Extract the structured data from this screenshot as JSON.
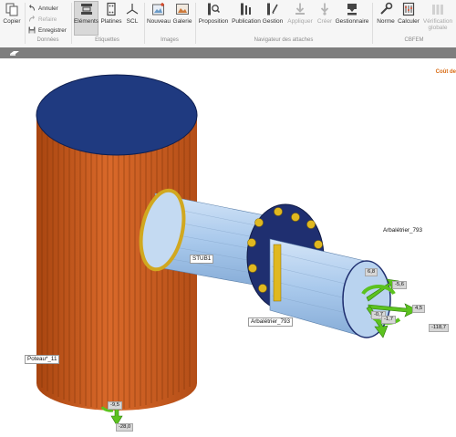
{
  "ribbon": {
    "copy_label": "Copier",
    "undo_label": "Annuler",
    "redo_label": "Refaire",
    "save_label": "Enregistrer",
    "group_data": "Données",
    "elements_label": "Eléments",
    "plates_label": "Platines",
    "scl_label": "SCL",
    "group_labels": "Etiquettes",
    "new_label": "Nouveau",
    "gallery_label": "Galerie",
    "group_images": "Images",
    "proposition_label": "Proposition",
    "publication_label": "Publication",
    "management_label": "Gestion",
    "apply_label": "Appliquer",
    "create_label": "Créer",
    "manager_label": "Gestionnaire",
    "group_navigator": "Navigateur des attaches",
    "norm_label": "Norme",
    "calculate_label": "Calculer",
    "verification_label_1": "Vérification",
    "verification_label_2": "globale",
    "group_cbfem": "CBFEM"
  },
  "viewport": {
    "cost_link": "Coût de",
    "labels": {
      "stub": "STUB1",
      "column": "Poteau*_11",
      "brace_right": "Arbalétrier_793",
      "brace_center": "Arbalétrier_793"
    },
    "values": {
      "col_small": "-9,5",
      "col_force": "-28,0",
      "v1": "6,8",
      "v2": "-5,6",
      "v3": "4,5",
      "v4": "-0,7",
      "v5": "-118,7",
      "v6": "-1,7"
    }
  },
  "colors": {
    "ribbon_bg": "#f6f6f6",
    "strip_bg": "#7e7e7e",
    "column_orange": "#c85d1d",
    "column_top": "#1f3a80",
    "pipe_blue": "#a9c9ec",
    "flange_navy": "#1f2f70",
    "bolts": "#e0b820",
    "force_green": "#5cc21f",
    "link_orange": "#d86a12"
  }
}
